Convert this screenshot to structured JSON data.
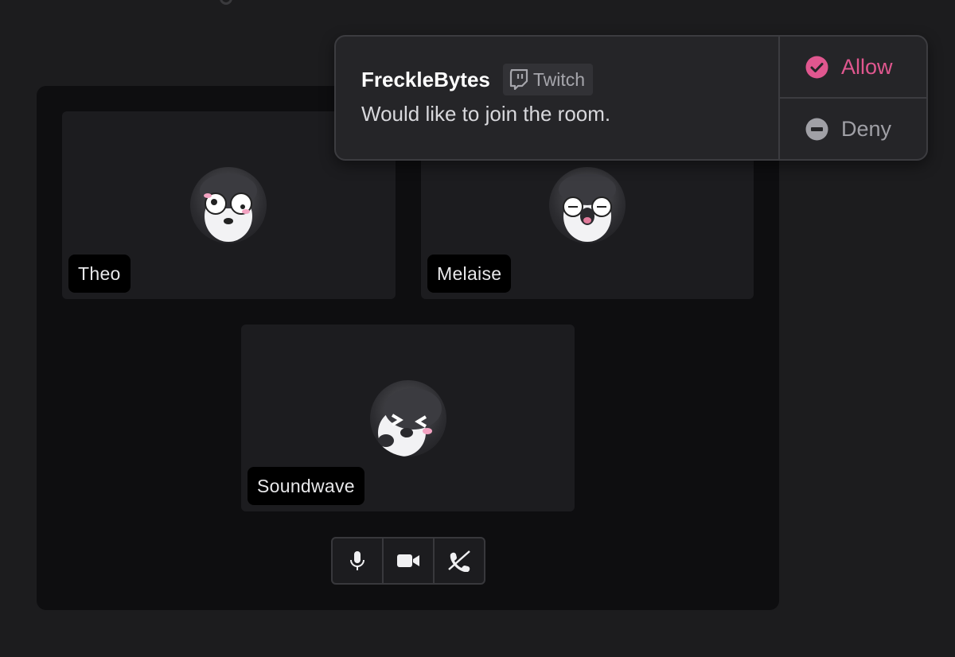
{
  "participants": [
    {
      "name": "Theo",
      "avatar_icon": "penguin-avatar-surprised"
    },
    {
      "name": "Melaise",
      "avatar_icon": "penguin-avatar-shocked"
    },
    {
      "name": "Soundwave",
      "avatar_icon": "penguin-avatar-laughing"
    }
  ],
  "controls": {
    "mic_icon": "microphone-icon",
    "camera_icon": "video-camera-icon",
    "hangup_icon": "hang-up-phone-icon"
  },
  "join_request": {
    "username": "FreckleBytes",
    "platform": "Twitch",
    "platform_icon": "twitch-icon",
    "message": "Would like to join the room.",
    "allow_label": "Allow",
    "deny_label": "Deny"
  },
  "colors": {
    "allow": "#e0578f",
    "deny": "#a0a0a6",
    "background": "#1c1c1e",
    "panel": "#0e0e10"
  }
}
